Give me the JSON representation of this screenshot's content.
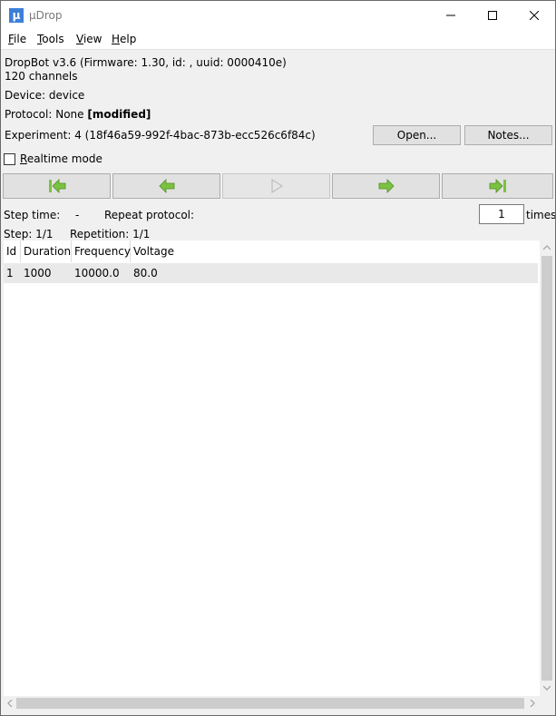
{
  "window": {
    "title": "µDrop",
    "icon_glyph": "µ",
    "accent": "#3c7fd8"
  },
  "menu": {
    "file": "File",
    "tools": "Tools",
    "view": "View",
    "help": "Help"
  },
  "device_info": {
    "dropbot_line": "DropBot v3.6 (Firmware: 1.30, id: , uuid: 0000410e)",
    "channels": "120 channels",
    "device": "Device: device",
    "protocol_prefix": "Protocol: None ",
    "protocol_modified": "[modified]",
    "experiment": "Experiment: 4 (18f46a59-992f-4bac-873b-ecc526c6f84c)"
  },
  "buttons": {
    "open": "Open...",
    "notes": "Notes..."
  },
  "realtime": {
    "label": "Realtime mode",
    "checked": false
  },
  "navigation": {
    "first_icon": "skip-to-first-icon",
    "prev_icon": "previous-arrow-icon",
    "play_icon": "play-icon",
    "next_icon": "next-arrow-icon",
    "last_icon": "skip-to-last-icon",
    "arrow_color": "#7cc242",
    "play_enabled": false
  },
  "status": {
    "step_time_label": "Step time:",
    "step_time_value": "-",
    "repeat_label": "Repeat protocol:",
    "repeat_value": "1",
    "repeat_suffix": "times",
    "step": "Step: 1/1",
    "repetition": "Repetition: 1/1"
  },
  "table": {
    "columns": [
      "Id",
      "Duration",
      "Frequency",
      "Voltage"
    ],
    "rows": [
      [
        "1",
        "1000",
        "10000.0",
        "80.0"
      ]
    ]
  }
}
